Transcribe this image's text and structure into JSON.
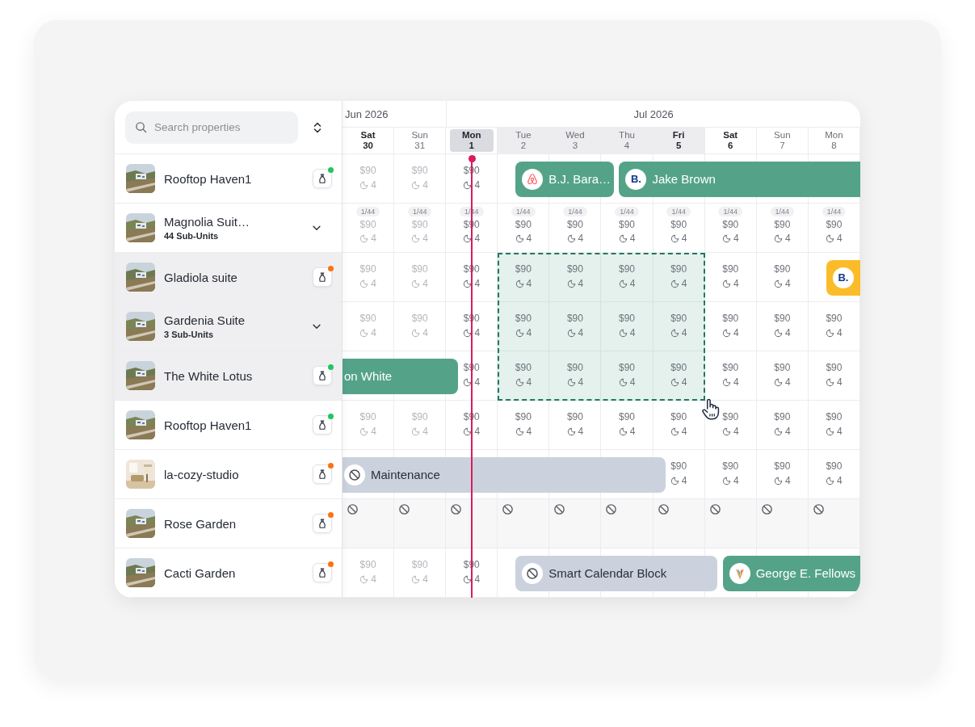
{
  "search": {
    "placeholder": "Search properties"
  },
  "months": [
    {
      "label": "Jun 2026",
      "days": [
        {
          "weekday": "Sat",
          "date": "30",
          "weekend": true,
          "past": true,
          "today": false,
          "selected": false
        },
        {
          "weekday": "Sun",
          "date": "31",
          "weekend": false,
          "past": true,
          "today": false,
          "selected": false
        }
      ]
    },
    {
      "label": "Jul 2026",
      "days": [
        {
          "weekday": "Mon",
          "date": "1",
          "weekend": false,
          "past": false,
          "today": true,
          "selected": false
        },
        {
          "weekday": "Tue",
          "date": "2",
          "weekend": false,
          "past": false,
          "today": false,
          "selected": true
        },
        {
          "weekday": "Wed",
          "date": "3",
          "weekend": false,
          "past": false,
          "today": false,
          "selected": true
        },
        {
          "weekday": "Thu",
          "date": "4",
          "weekend": false,
          "past": false,
          "today": false,
          "selected": true
        },
        {
          "weekday": "Fri",
          "date": "5",
          "weekend": true,
          "past": false,
          "today": false,
          "selected": true
        },
        {
          "weekday": "Sat",
          "date": "6",
          "weekend": true,
          "past": false,
          "today": false,
          "selected": false
        },
        {
          "weekday": "Sun",
          "date": "7",
          "weekend": false,
          "past": false,
          "today": false,
          "selected": false
        },
        {
          "weekday": "Mon",
          "date": "8",
          "weekend": false,
          "past": false,
          "today": false,
          "selected": false
        }
      ]
    }
  ],
  "properties": [
    {
      "name": "Rooftop Haven1",
      "kind": "unit",
      "color": "#22c55e",
      "selected": false,
      "cells": [
        {
          "kind": "price",
          "price": "$90",
          "nights": "4",
          "selected": false
        },
        {
          "kind": "price",
          "price": "$90",
          "nights": "4",
          "selected": false
        },
        {
          "kind": "price",
          "price": "$90",
          "nights": "4",
          "selected": false
        },
        {
          "kind": "reservation",
          "logo": {
            "kind": "loop"
          },
          "guest": "B.J. Bara…",
          "color": "#54a389"
        },
        {
          "kind": "continued"
        },
        {
          "kind": "reservation",
          "logo": {
            "kind": "text",
            "text": "B."
          },
          "guest": "Jake Brown",
          "color": "#54a389"
        },
        {
          "kind": "continued"
        },
        {
          "kind": "continued"
        },
        {
          "kind": "continued"
        },
        {
          "kind": "continued"
        }
      ]
    },
    {
      "name": "Magnolia Suit…",
      "kind": "group",
      "subtitle": "44 Sub-Units",
      "selected": false,
      "cells": [
        {
          "kind": "multi",
          "units": "1/44",
          "price": "$90",
          "nights": "4",
          "selected": false
        },
        {
          "kind": "multi",
          "units": "1/44",
          "price": "$90",
          "nights": "4",
          "selected": false
        },
        {
          "kind": "multi",
          "units": "1/44",
          "price": "$90",
          "nights": "4",
          "selected": false
        },
        {
          "kind": "multi",
          "units": "1/44",
          "price": "$90",
          "nights": "4",
          "selected": false
        },
        {
          "kind": "multi",
          "units": "1/44",
          "price": "$90",
          "nights": "4",
          "selected": false
        },
        {
          "kind": "multi",
          "units": "1/44",
          "price": "$90",
          "nights": "4",
          "selected": false
        },
        {
          "kind": "multi",
          "units": "1/44",
          "price": "$90",
          "nights": "4",
          "selected": false
        },
        {
          "kind": "multi",
          "units": "1/44",
          "price": "$90",
          "nights": "4",
          "selected": false
        },
        {
          "kind": "multi",
          "units": "1/44",
          "price": "$90",
          "nights": "4",
          "selected": false
        },
        {
          "kind": "multi",
          "units": "1/44",
          "price": "$90",
          "nights": "4",
          "selected": false
        }
      ]
    },
    {
      "name": "Gladiola suite",
      "kind": "unit",
      "color": "#f97316",
      "selected": true,
      "cells": [
        {
          "kind": "price",
          "price": "$90",
          "nights": "4",
          "selected": false
        },
        {
          "kind": "price",
          "price": "$90",
          "nights": "4",
          "selected": false
        },
        {
          "kind": "price",
          "price": "$90",
          "nights": "4",
          "selected": false
        },
        {
          "kind": "price",
          "price": "$90",
          "nights": "4",
          "selected": true
        },
        {
          "kind": "price",
          "price": "$90",
          "nights": "4",
          "selected": true
        },
        {
          "kind": "price",
          "price": "$90",
          "nights": "4",
          "selected": true
        },
        {
          "kind": "price",
          "price": "$90",
          "nights": "4",
          "selected": true
        },
        {
          "kind": "price",
          "price": "$90",
          "nights": "4",
          "selected": false
        },
        {
          "kind": "price",
          "price": "$90",
          "nights": "4",
          "selected": false
        },
        {
          "kind": "reservation",
          "logo": {
            "kind": "text",
            "text": "B."
          },
          "color": "#fbbc2a"
        }
      ]
    },
    {
      "name": "Gardenia Suite",
      "kind": "group",
      "subtitle": "3 Sub-Units",
      "selected": true,
      "cells": [
        {
          "kind": "price",
          "price": "$90",
          "nights": "4",
          "selected": false
        },
        {
          "kind": "price",
          "price": "$90",
          "nights": "4",
          "selected": false
        },
        {
          "kind": "price",
          "price": "$90",
          "nights": "4",
          "selected": false
        },
        {
          "kind": "price",
          "price": "$90",
          "nights": "4",
          "selected": true
        },
        {
          "kind": "price",
          "price": "$90",
          "nights": "4",
          "selected": true
        },
        {
          "kind": "price",
          "price": "$90",
          "nights": "4",
          "selected": true
        },
        {
          "kind": "price",
          "price": "$90",
          "nights": "4",
          "selected": true
        },
        {
          "kind": "price",
          "price": "$90",
          "nights": "4",
          "selected": false
        },
        {
          "kind": "price",
          "price": "$90",
          "nights": "4",
          "selected": false
        },
        {
          "kind": "price",
          "price": "$90",
          "nights": "4",
          "selected": false
        }
      ]
    },
    {
      "name": "The White Lotus",
      "kind": "unit",
      "color": "#22c55e",
      "selected": true,
      "cells": [
        {
          "kind": "reservation",
          "guest": "on White",
          "color": "#54a389"
        },
        {
          "kind": "continued"
        },
        {
          "kind": "price",
          "price": "$90",
          "nights": "4",
          "selected": false
        },
        {
          "kind": "price",
          "price": "$90",
          "nights": "4",
          "selected": true
        },
        {
          "kind": "price",
          "price": "$90",
          "nights": "4",
          "selected": true
        },
        {
          "kind": "price",
          "price": "$90",
          "nights": "4",
          "selected": true
        },
        {
          "kind": "price",
          "price": "$90",
          "nights": "4",
          "selected": true
        },
        {
          "kind": "price",
          "price": "$90",
          "nights": "4",
          "selected": false
        },
        {
          "kind": "price",
          "price": "$90",
          "nights": "4",
          "selected": false
        },
        {
          "kind": "price",
          "price": "$90",
          "nights": "4",
          "selected": false
        }
      ]
    },
    {
      "name": "Rooftop Haven1",
      "kind": "unit",
      "color": "#22c55e",
      "selected": false,
      "cells": [
        {
          "kind": "price",
          "price": "$90",
          "nights": "4",
          "selected": false
        },
        {
          "kind": "price",
          "price": "$90",
          "nights": "4",
          "selected": false
        },
        {
          "kind": "price",
          "price": "$90",
          "nights": "4",
          "selected": false
        },
        {
          "kind": "price",
          "price": "$90",
          "nights": "4",
          "selected": false
        },
        {
          "kind": "price",
          "price": "$90",
          "nights": "4",
          "selected": false
        },
        {
          "kind": "price",
          "price": "$90",
          "nights": "4",
          "selected": false
        },
        {
          "kind": "price",
          "price": "$90",
          "nights": "4",
          "selected": false
        },
        {
          "kind": "price",
          "price": "$90",
          "nights": "4",
          "selected": false
        },
        {
          "kind": "price",
          "price": "$90",
          "nights": "4",
          "selected": false
        },
        {
          "kind": "price",
          "price": "$90",
          "nights": "4",
          "selected": false
        }
      ]
    },
    {
      "name": "la-cozy-studio",
      "kind": "unit",
      "color": "#f97316",
      "selected": false,
      "cells": [
        {
          "kind": "block",
          "label": "Maintenance"
        },
        {
          "kind": "continued"
        },
        {
          "kind": "continued"
        },
        {
          "kind": "continued"
        },
        {
          "kind": "continued"
        },
        {
          "kind": "continued"
        },
        {
          "kind": "price",
          "price": "$90",
          "nights": "4",
          "selected": false
        },
        {
          "kind": "price",
          "price": "$90",
          "nights": "4",
          "selected": false
        },
        {
          "kind": "price",
          "price": "$90",
          "nights": "4",
          "selected": false
        },
        {
          "kind": "price",
          "price": "$90",
          "nights": "4",
          "selected": false
        }
      ]
    },
    {
      "name": "Rose Garden",
      "kind": "unit",
      "color": "#f97316",
      "selected": false,
      "cells": [
        {
          "kind": "unavailable",
          "selected": false
        },
        {
          "kind": "unavailable",
          "selected": false
        },
        {
          "kind": "unavailable",
          "selected": false
        },
        {
          "kind": "unavailable",
          "selected": false
        },
        {
          "kind": "unavailable",
          "selected": false
        },
        {
          "kind": "unavailable",
          "selected": false
        },
        {
          "kind": "unavailable",
          "selected": false
        },
        {
          "kind": "unavailable",
          "selected": false
        },
        {
          "kind": "unavailable",
          "selected": false
        },
        {
          "kind": "unavailable",
          "selected": false
        }
      ]
    },
    {
      "name": "Cacti Garden",
      "kind": "unit",
      "color": "#f97316",
      "selected": false,
      "cells": [
        {
          "kind": "price",
          "price": "$90",
          "nights": "4",
          "selected": false
        },
        {
          "kind": "price",
          "price": "$90",
          "nights": "4",
          "selected": false
        },
        {
          "kind": "price",
          "price": "$90",
          "nights": "4",
          "selected": false
        },
        {
          "kind": "block",
          "label": "Smart Calendar Block"
        },
        {
          "kind": "continued"
        },
        {
          "kind": "continued"
        },
        {
          "kind": "continued"
        },
        {
          "kind": "reservation",
          "logo": {
            "kind": "mark"
          },
          "guest": "George E. Fellows",
          "color": "#54a389"
        },
        {
          "kind": "continued"
        },
        {
          "kind": "continued"
        }
      ]
    }
  ]
}
